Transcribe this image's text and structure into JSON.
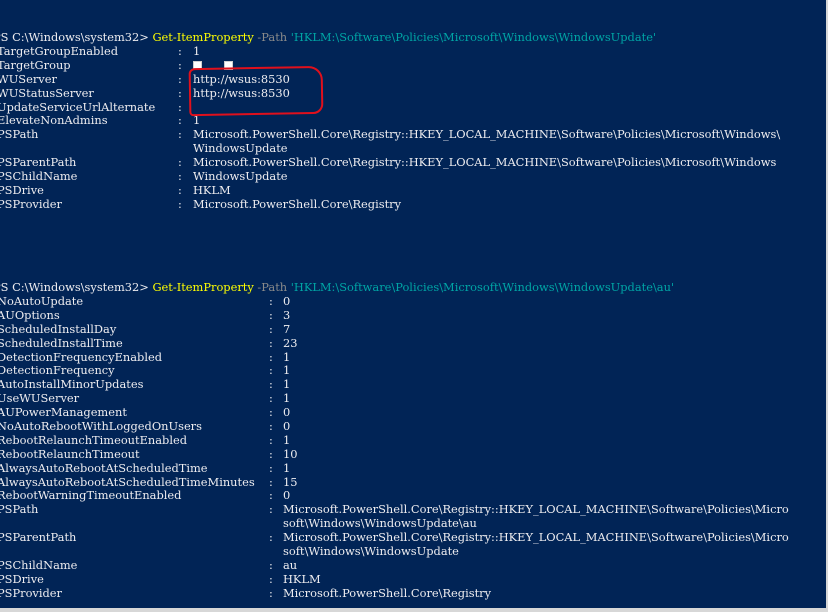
{
  "console": {
    "background": "#012456",
    "command1": {
      "prompt": "PS C:\\Windows\\system32> ",
      "cmdlet": "Get-ItemProperty",
      "param": " -Path ",
      "path": "'HKLM:\\Software\\Policies\\Microsoft\\Windows\\WindowsUpdate'"
    },
    "output1": [
      {
        "name": "TargetGroupEnabled",
        "value": "1"
      },
      {
        "name": "TargetGroup",
        "value": ""
      },
      {
        "name": "WUServer",
        "value": "http://wsus:8530"
      },
      {
        "name": "WUStatusServer",
        "value": "http://wsus:8530"
      },
      {
        "name": "UpdateServiceUrlAlternate",
        "value": ""
      },
      {
        "name": "ElevateNonAdmins",
        "value": "1"
      },
      {
        "name": "PSPath",
        "value": "Microsoft.PowerShell.Core\\Registry::HKEY_LOCAL_MACHINE\\Software\\Policies\\Microsoft\\Windows\\",
        "cont": "WindowsUpdate"
      },
      {
        "name": "PSParentPath",
        "value": "Microsoft.PowerShell.Core\\Registry::HKEY_LOCAL_MACHINE\\Software\\Policies\\Microsoft\\Windows"
      },
      {
        "name": "PSChildName",
        "value": "WindowsUpdate"
      },
      {
        "name": "PSDrive",
        "value": "HKLM"
      },
      {
        "name": "PSProvider",
        "value": "Microsoft.PowerShell.Core\\Registry"
      }
    ],
    "command2": {
      "prompt": "PS C:\\Windows\\system32> ",
      "cmdlet": "Get-ItemProperty",
      "param": " -Path ",
      "path": "'HKLM:\\Software\\Policies\\Microsoft\\Windows\\WindowsUpdate\\au'"
    },
    "output2": [
      {
        "name": "NoAutoUpdate",
        "value": "0"
      },
      {
        "name": "AUOptions",
        "value": "3"
      },
      {
        "name": "ScheduledInstallDay",
        "value": "7"
      },
      {
        "name": "ScheduledInstallTime",
        "value": "23"
      },
      {
        "name": "DetectionFrequencyEnabled",
        "value": "1"
      },
      {
        "name": "DetectionFrequency",
        "value": "1"
      },
      {
        "name": "AutoInstallMinorUpdates",
        "value": "1"
      },
      {
        "name": "UseWUServer",
        "value": "1"
      },
      {
        "name": "AUPowerManagement",
        "value": "0"
      },
      {
        "name": "NoAutoRebootWithLoggedOnUsers",
        "value": "0"
      },
      {
        "name": "RebootRelaunchTimeoutEnabled",
        "value": "1"
      },
      {
        "name": "RebootRelaunchTimeout",
        "value": "10"
      },
      {
        "name": "AlwaysAutoRebootAtScheduledTime",
        "value": "1"
      },
      {
        "name": "AlwaysAutoRebootAtScheduledTimeMinutes",
        "value": "15"
      },
      {
        "name": "RebootWarningTimeoutEnabled",
        "value": "0"
      },
      {
        "name": "PSPath",
        "value": "Microsoft.PowerShell.Core\\Registry::HKEY_LOCAL_MACHINE\\Software\\Policies\\Micro",
        "cont": "soft\\Windows\\WindowsUpdate\\au"
      },
      {
        "name": "PSParentPath",
        "value": "Microsoft.PowerShell.Core\\Registry::HKEY_LOCAL_MACHINE\\Software\\Policies\\Micro",
        "cont": "soft\\Windows\\WindowsUpdate"
      },
      {
        "name": "PSChildName",
        "value": "au"
      },
      {
        "name": "PSDrive",
        "value": "HKLM"
      },
      {
        "name": "PSProvider",
        "value": "Microsoft.PowerShell.Core\\Registry"
      }
    ],
    "separator": ":",
    "annotation": {
      "color": "#e0101c"
    }
  }
}
